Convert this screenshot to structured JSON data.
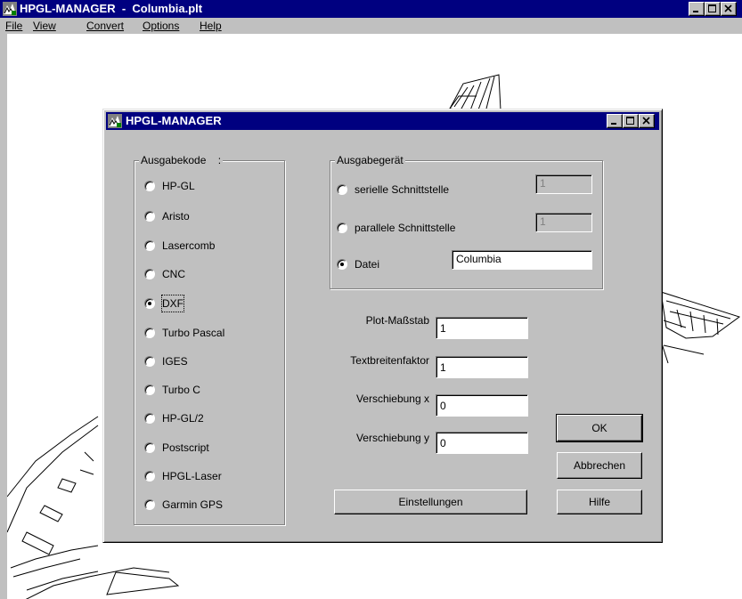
{
  "main_window": {
    "title": "HPGL-MANAGER  -  Columbia.plt",
    "menu": [
      {
        "label": "File"
      },
      {
        "label": "View"
      },
      {
        "label": "Convert"
      },
      {
        "label": "Options"
      },
      {
        "label": "Help"
      }
    ]
  },
  "dialog": {
    "title": "HPGL-MANAGER",
    "output_code": {
      "label": "Ausgabekode    :",
      "selected": "DXF",
      "options": [
        "HP-GL",
        "Aristo",
        "Lasercomb",
        "CNC",
        "DXF",
        "Turbo Pascal",
        "IGES",
        "Turbo C",
        "HP-GL/2",
        "Postscript",
        "HPGL-Laser",
        "Garmin GPS"
      ]
    },
    "output_device": {
      "label": "Ausgabegerät",
      "selected": "Datei",
      "serial": {
        "label": "serielle Schnittstelle",
        "value": "1"
      },
      "parallel": {
        "label": "parallele Schnittstelle",
        "value": "1"
      },
      "file": {
        "label": "Datei",
        "value": "Columbia"
      }
    },
    "params": {
      "plot_scale": {
        "label": "Plot-Maßstab",
        "value": "1"
      },
      "text_width": {
        "label": "Textbreitenfaktor",
        "value": "1"
      },
      "shift_x": {
        "label": "Verschiebung x",
        "value": "0"
      },
      "shift_y": {
        "label": "Verschiebung y",
        "value": "0"
      }
    },
    "buttons": {
      "settings": "Einstellungen",
      "ok": "OK",
      "cancel": "Abbrechen",
      "help": "Hilfe"
    }
  },
  "colors": {
    "titlebar": "#000080",
    "face": "#c0c0c0",
    "canvas": "#ffffff"
  }
}
